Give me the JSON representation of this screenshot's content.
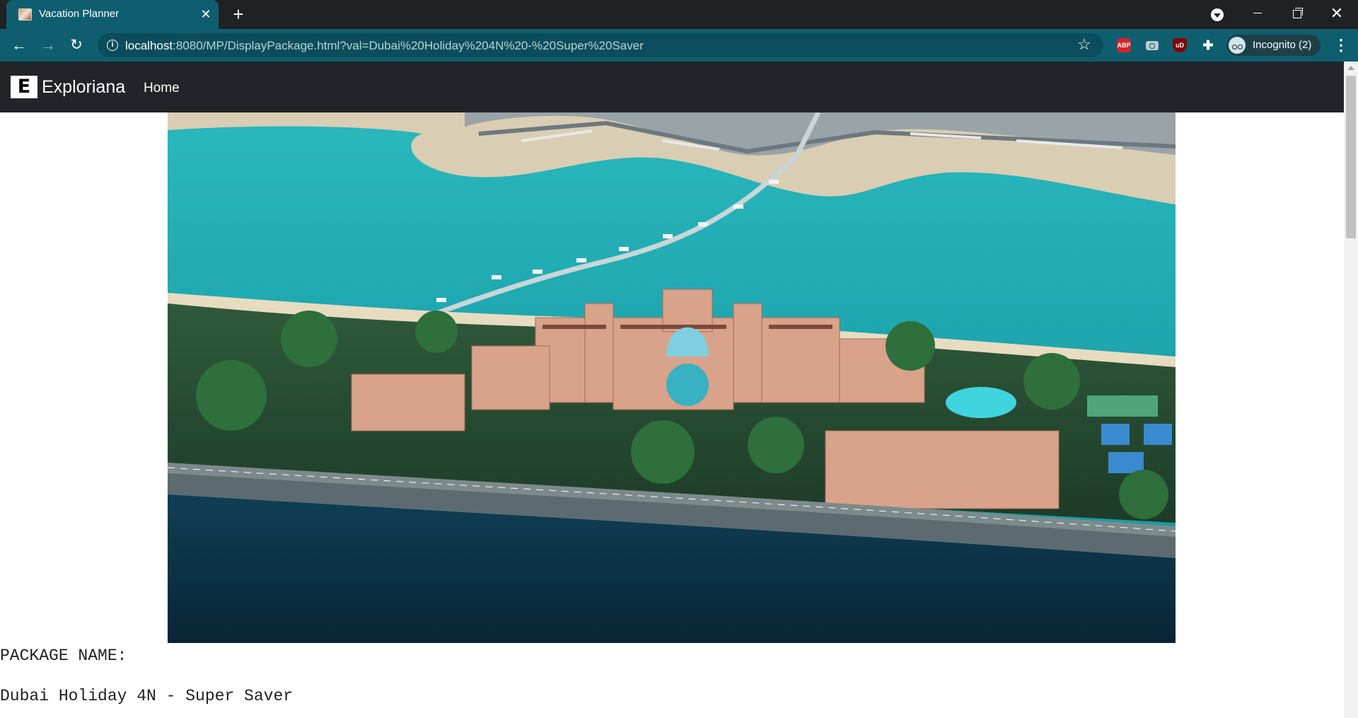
{
  "browser": {
    "tab_title": "Vacation Planner",
    "tab_close": "✕",
    "new_tab": "+",
    "url_host": "localhost",
    "url_rest": ":8080/MP/DisplayPackage.html?val=Dubai%20Holiday%204N%20-%20Super%20Saver",
    "profile_label": "Incognito (2)",
    "extensions": [
      "adblock-plus-icon",
      "screenshot-camera-icon",
      "ublock-origin-icon",
      "extensions-puzzle-icon"
    ],
    "ext_abp_text": "ABP",
    "ext_ubo_text": "uD",
    "colors": {
      "titlebar": "#202124",
      "toolbar": "#0e5e6f",
      "omnibox": "#0b4d5c"
    }
  },
  "site": {
    "brand_letter": "E",
    "brand_name": "Exploriana",
    "nav_home": "Home",
    "navbar_color": "#212529"
  },
  "package": {
    "hero_image": "aerial view of resort hotel on island beach with bridge and turquoise water",
    "label": "PACKAGE NAME:",
    "name": "Dubai Holiday 4N - Super Saver"
  }
}
